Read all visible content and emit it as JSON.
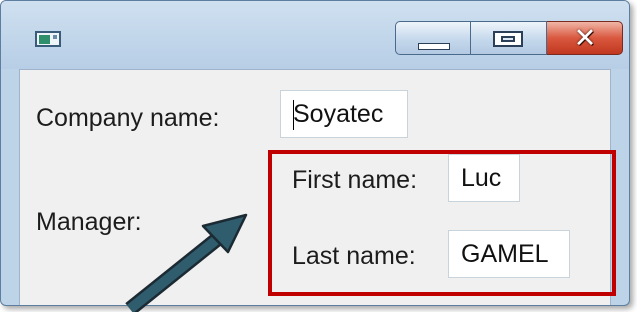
{
  "window": {
    "title": "",
    "icon": "app-icon",
    "controls": [
      "minimize-icon",
      "maximize-icon",
      "close-icon"
    ],
    "close_glyph": "✕"
  },
  "form": {
    "company_label": "Company name:",
    "company_value": "Soyatec",
    "manager_label": "Manager:",
    "first_name_label": "First name:",
    "first_name_value": "Luc",
    "last_name_label": "Last name:",
    "last_name_value": "GAMEL"
  },
  "annotation": {
    "highlight_color": "#c00000",
    "arrow_color": "#2f5d6e"
  }
}
